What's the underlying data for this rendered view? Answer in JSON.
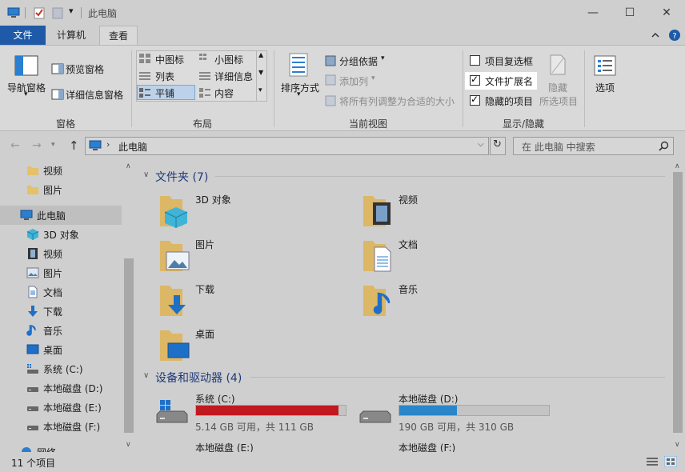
{
  "window": {
    "title": "此电脑"
  },
  "tabs": [
    {
      "label": "文件",
      "active": false
    },
    {
      "label": "计算机",
      "active": false
    },
    {
      "label": "查看",
      "active": true
    }
  ],
  "ribbon": {
    "pane": {
      "label": "窗格",
      "nav_pane": "导航窗格",
      "preview_pane": "预览窗格",
      "details_pane": "详细信息窗格"
    },
    "layout": {
      "label": "布局",
      "options": [
        "中图标",
        "小图标",
        "列表",
        "详细信息",
        "平铺",
        "内容"
      ],
      "selected": "平铺"
    },
    "current_view": {
      "label": "当前视图",
      "sort_by": "排序方式",
      "group_by": "分组依据",
      "add_columns": "添加列",
      "fit_columns": "将所有列调整为合适的大小"
    },
    "show_hide": {
      "label": "显示/隐藏",
      "item_checkboxes": {
        "label": "项目复选框",
        "checked": false
      },
      "file_extensions": {
        "label": "文件扩展名",
        "checked": true
      },
      "hidden_items": {
        "label": "隐藏的项目",
        "checked": true
      },
      "hide_selected_1": "隐藏",
      "hide_selected_2": "所选项目"
    },
    "options": {
      "label": "选项"
    }
  },
  "address": {
    "path": "此电脑",
    "search_placeholder": "在 此电脑 中搜索"
  },
  "nav_pane": {
    "items": [
      {
        "label": "视频",
        "icon": "folder-icon"
      },
      {
        "label": "图片",
        "icon": "folder-icon"
      },
      {
        "label": "此电脑",
        "icon": "computer-icon",
        "selected": true
      },
      {
        "label": "3D 对象",
        "icon": "3d-objects-icon"
      },
      {
        "label": "视频",
        "icon": "video-icon"
      },
      {
        "label": "图片",
        "icon": "picture-icon"
      },
      {
        "label": "文档",
        "icon": "document-icon"
      },
      {
        "label": "下载",
        "icon": "download-icon"
      },
      {
        "label": "音乐",
        "icon": "music-icon"
      },
      {
        "label": "桌面",
        "icon": "desktop-icon"
      },
      {
        "label": "系统 (C:)",
        "icon": "drive-icon"
      },
      {
        "label": "本地磁盘 (D:)",
        "icon": "drive-icon"
      },
      {
        "label": "本地磁盘 (E:)",
        "icon": "drive-icon"
      },
      {
        "label": "本地磁盘 (F:)",
        "icon": "drive-icon"
      },
      {
        "label": "网络",
        "icon": "network-icon"
      }
    ]
  },
  "content": {
    "folders_header": "文件夹 (7)",
    "folders": [
      {
        "label": "3D 对象",
        "icon": "3d-objects-icon"
      },
      {
        "label": "视频",
        "icon": "video-icon"
      },
      {
        "label": "图片",
        "icon": "picture-icon"
      },
      {
        "label": "文档",
        "icon": "document-icon"
      },
      {
        "label": "下载",
        "icon": "download-icon"
      },
      {
        "label": "音乐",
        "icon": "music-icon"
      },
      {
        "label": "桌面",
        "icon": "desktop-icon"
      }
    ],
    "drives_header": "设备和驱动器 (4)",
    "drives": [
      {
        "label": "系统 (C:)",
        "info": "5.14 GB 可用，共 111 GB",
        "used_fraction": 0.954,
        "bar_color": "#c0191f"
      },
      {
        "label": "本地磁盘 (D:)",
        "info": "190 GB 可用，共 310 GB",
        "used_fraction": 0.387,
        "bar_color": "#2a86c9"
      },
      {
        "label": "本地磁盘 (E:)"
      },
      {
        "label": "本地磁盘 (F:)"
      }
    ]
  },
  "status": {
    "count": "11 个项目"
  }
}
